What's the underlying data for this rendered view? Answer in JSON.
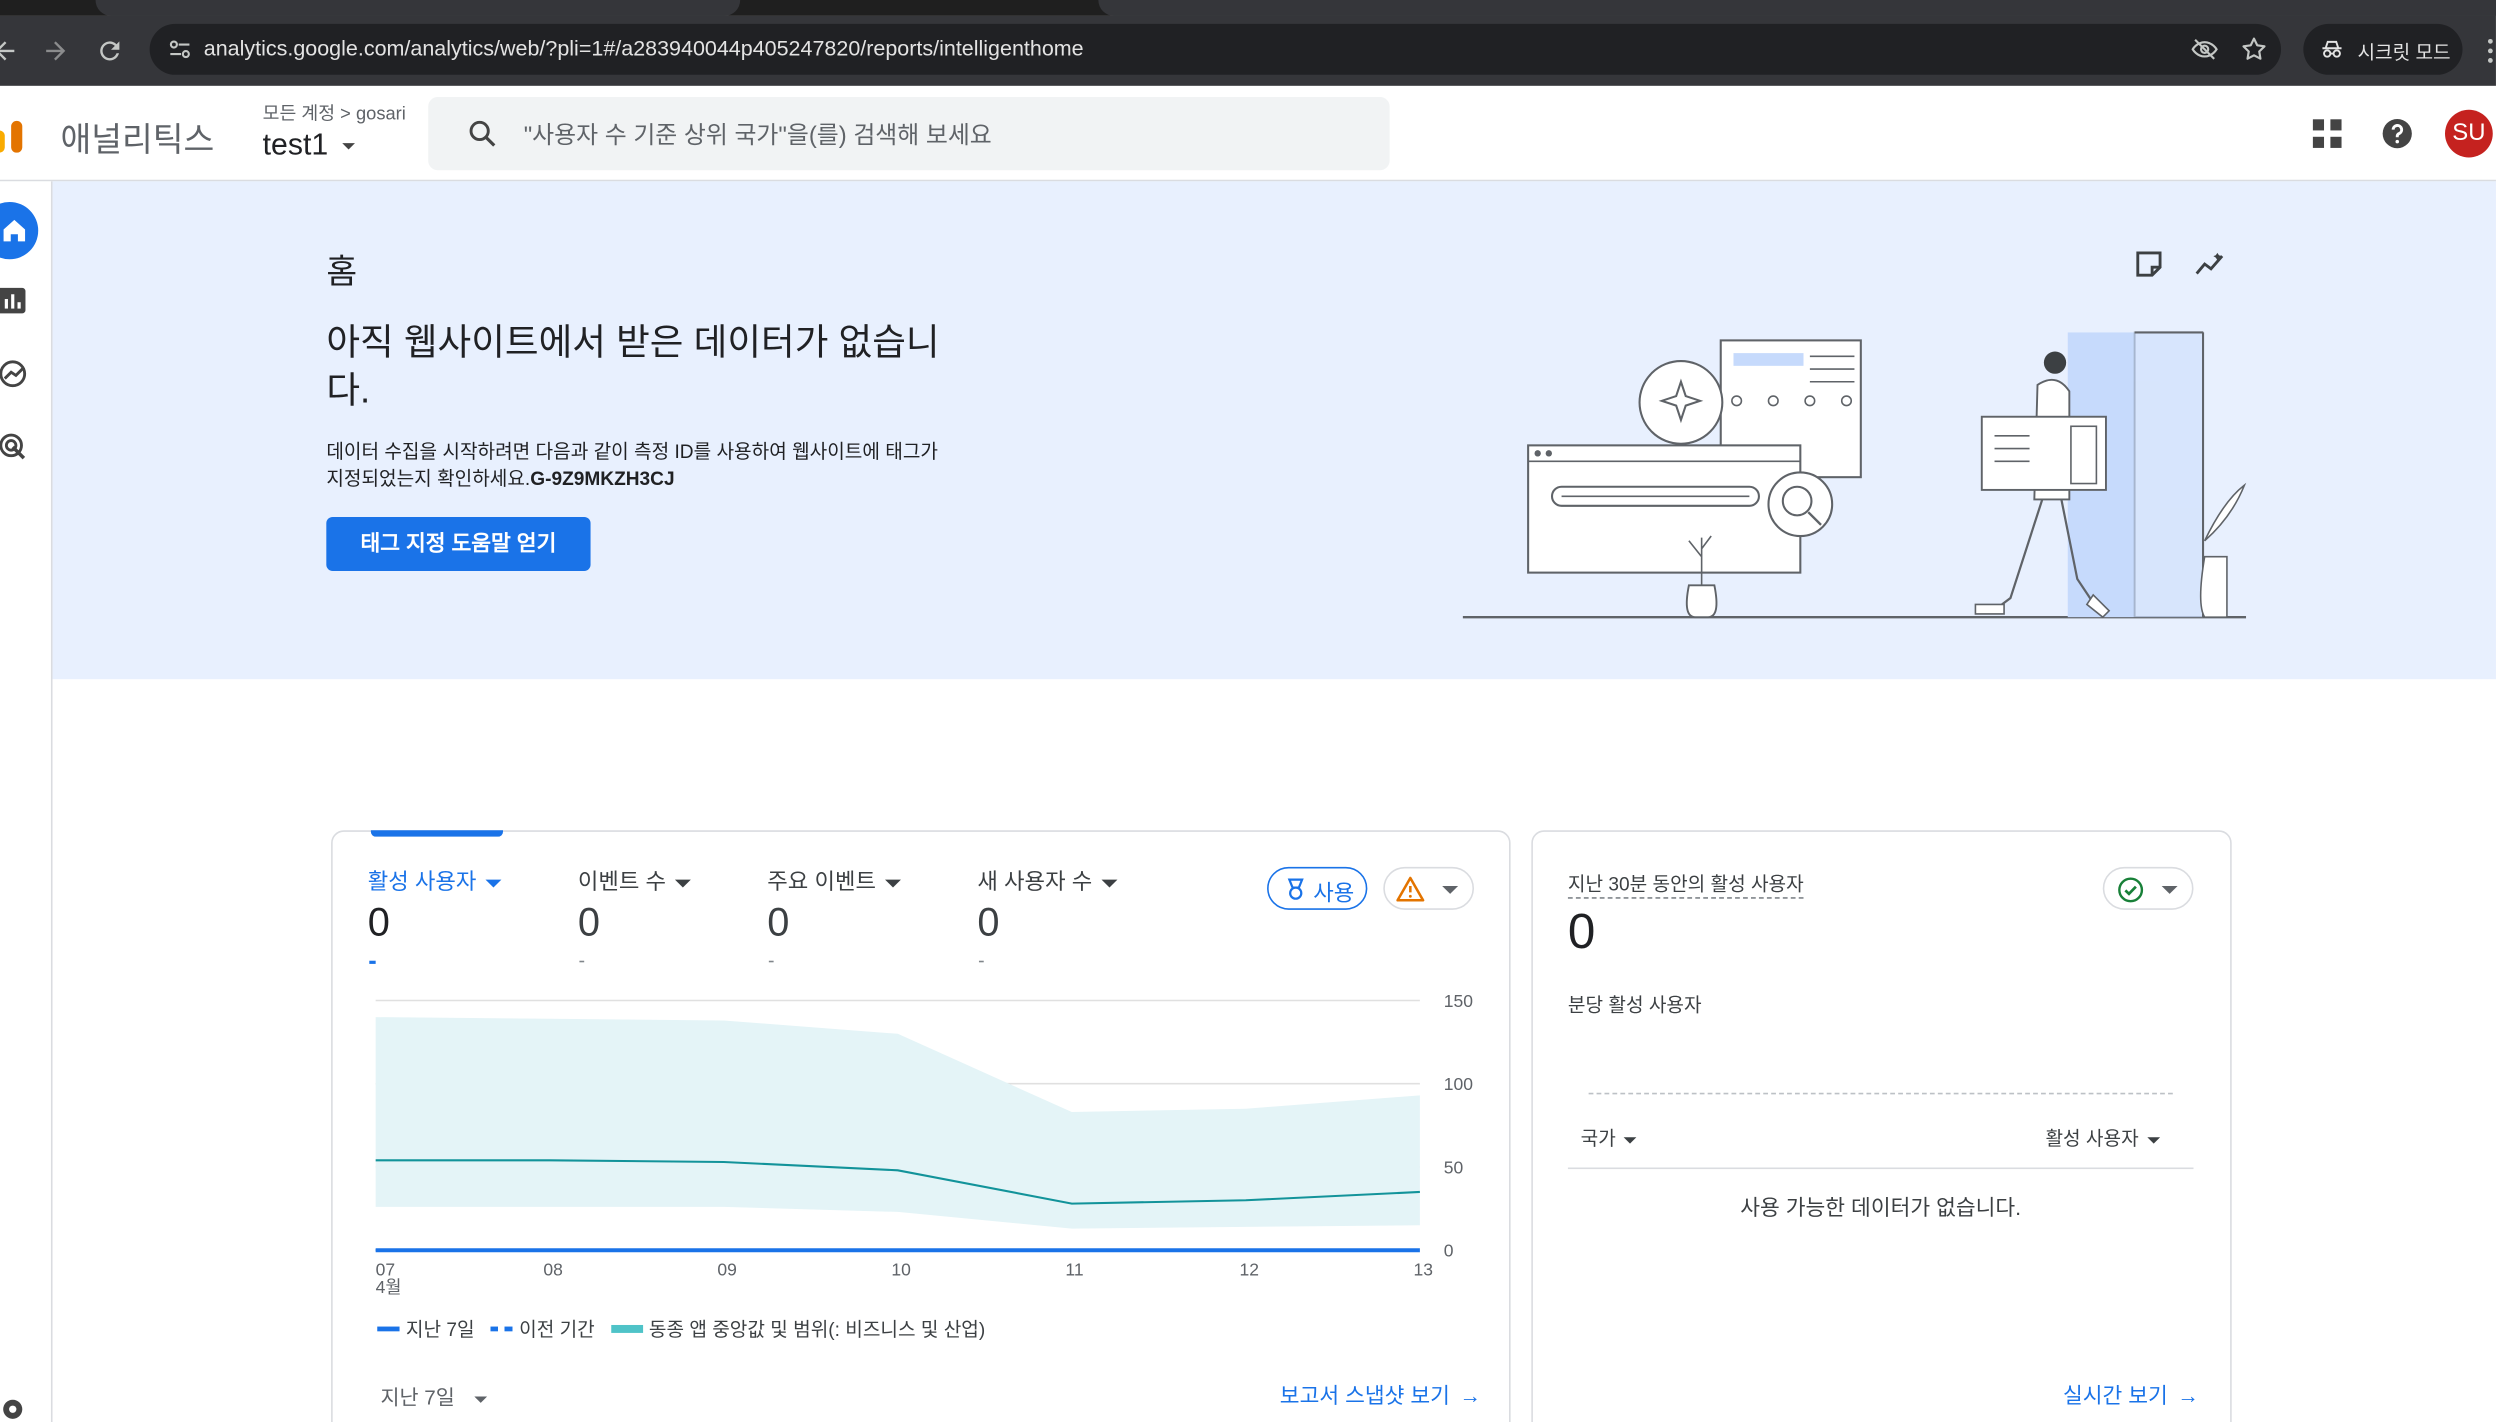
{
  "browser": {
    "url": "analytics.google.com/analytics/web/?pli=1#/a283940044p405247820/reports/intelligenthome",
    "incognito_label": "시크릿 모드"
  },
  "header": {
    "brand": "애널리틱스",
    "account_path": "모든 계정 > gosari",
    "property_name": "test1",
    "search_placeholder": "\"사용자 수 기준 상위 국가\"을(를) 검색해 보세요",
    "avatar_initials": "SU",
    "avatar_color": "#c5221f"
  },
  "hero": {
    "page_title": "홈",
    "heading": "아직 웹사이트에서 받은 데이터가 없습니다.",
    "body": "데이터 수집을 시작하려면 다음과 같이 측정 ID를 사용하여 웹사이트에 태그가 지정되었는지 확인하세요.",
    "measurement_id": "G-9Z9MKZH3CJ",
    "button": "태그 지정 도움말 얻기"
  },
  "overview_card": {
    "metrics": [
      {
        "label": "활성 사용자",
        "value": "0",
        "active": true
      },
      {
        "label": "이벤트 수",
        "value": "0",
        "active": false
      },
      {
        "label": "주요 이벤트",
        "value": "0",
        "active": false
      },
      {
        "label": "새 사용자 수",
        "value": "0",
        "active": false
      }
    ],
    "use_button": "사용",
    "legend": [
      "지난 7일",
      "이전 기간",
      "동종 앱 중앙값 및 범위(: 비즈니스 및 산업)"
    ],
    "date_range": "지난 7일",
    "snapshot_link": "보고서 스냅샷 보기"
  },
  "realtime_card": {
    "title": "지난 30분 동안의 활성 사용자",
    "value": "0",
    "subtitle": "분당 활성 사용자",
    "col_country": "국가",
    "col_users": "활성 사용자",
    "empty_text": "사용 가능한 데이터가 없습니다.",
    "link": "실시간 보기"
  },
  "chart_data": {
    "type": "area",
    "categories": [
      "07",
      "08",
      "09",
      "10",
      "11",
      "12",
      "13"
    ],
    "month_label": "4월",
    "ylim": [
      0,
      150
    ],
    "y_ticks": [
      0,
      50,
      100,
      150
    ],
    "grid": true,
    "series": [
      {
        "name": "지난 7일",
        "values": [
          0,
          0,
          0,
          0,
          0,
          0,
          0
        ],
        "color": "#1a73e8"
      },
      {
        "name": "이전 기간",
        "values": [
          0,
          0,
          0,
          0,
          0,
          0,
          0
        ],
        "color": "#1a73e8"
      },
      {
        "name": "동종 앱 중앙값 및 범위(: 비즈니스 및 산업)",
        "values": [
          54,
          54,
          53,
          48,
          28,
          30,
          35
        ],
        "color": "#12939a"
      }
    ],
    "range_band": {
      "upper": [
        140,
        139,
        138,
        130,
        83,
        85,
        93
      ],
      "lower": [
        26,
        26,
        26,
        23,
        13,
        14,
        15
      ],
      "color": "#e4f4f7"
    }
  }
}
